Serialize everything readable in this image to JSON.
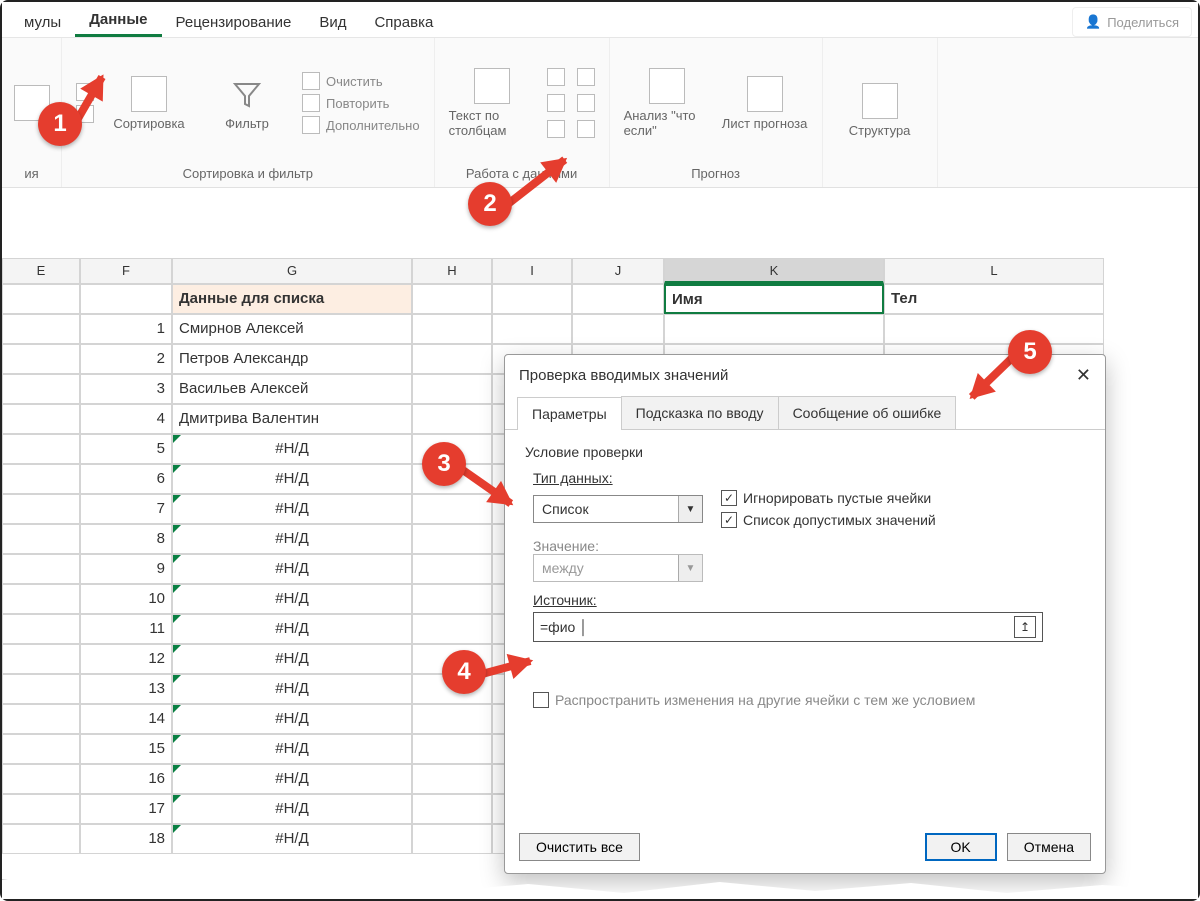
{
  "tabs": {
    "formulas": "мулы",
    "data": "Данные",
    "review": "Рецензирование",
    "view": "Вид",
    "help": "Справка"
  },
  "share": {
    "label": "Поделиться"
  },
  "ribbon": {
    "sort_label": "Сортировка",
    "filter_label": "Фильтр",
    "clear": "Очистить",
    "reapply": "Повторить",
    "advanced": "Дополнительно",
    "group_sortfilter": "Сортировка и фильтр",
    "text_to_columns": "Текст по столбцам",
    "group_datatools": "Работа с данными",
    "whatif": "Анализ \"что если\"",
    "forecast_sheet": "Лист прогноза",
    "group_forecast": "Прогноз",
    "outline": "Структура"
  },
  "columns": {
    "e": "E",
    "f": "F",
    "g": "G",
    "h": "H",
    "i": "I",
    "j": "J",
    "k": "K",
    "l": "L"
  },
  "headers": {
    "g": "Данные для списка",
    "k": "Имя",
    "l": "Тел"
  },
  "rows": [
    {
      "n": 1,
      "g": "Смирнов Алексей"
    },
    {
      "n": 2,
      "g": "Петров Александр"
    },
    {
      "n": 3,
      "g": "Васильев Алексей"
    },
    {
      "n": 4,
      "g": "Дмитрива Валентин"
    },
    {
      "n": 5,
      "g": "#Н/Д"
    },
    {
      "n": 6,
      "g": "#Н/Д"
    },
    {
      "n": 7,
      "g": "#Н/Д"
    },
    {
      "n": 8,
      "g": "#Н/Д"
    },
    {
      "n": 9,
      "g": "#Н/Д"
    },
    {
      "n": 10,
      "g": "#Н/Д"
    },
    {
      "n": 11,
      "g": "#Н/Д"
    },
    {
      "n": 12,
      "g": "#Н/Д"
    },
    {
      "n": 13,
      "g": "#Н/Д"
    },
    {
      "n": 14,
      "g": "#Н/Д"
    },
    {
      "n": 15,
      "g": "#Н/Д"
    },
    {
      "n": 16,
      "g": "#Н/Д"
    },
    {
      "n": 17,
      "g": "#Н/Д"
    },
    {
      "n": 18,
      "g": "#Н/Д"
    }
  ],
  "dialog": {
    "title": "Проверка вводимых значений",
    "tabs": {
      "params": "Параметры",
      "input_msg": "Подсказка по вводу",
      "error_msg": "Сообщение об ошибке"
    },
    "section": "Условие проверки",
    "type_label": "Тип данных:",
    "type_value": "Список",
    "value_label": "Значение:",
    "value_value": "между",
    "ignore_blank": "Игнорировать пустые ячейки",
    "in_cell_dropdown": "Список допустимых значений",
    "source_label": "Источник:",
    "source_value": "=фио",
    "apply_changes": "Распространить изменения на другие ячейки с тем же условием",
    "clear_all": "Очистить все",
    "ok": "OK",
    "cancel": "Отмена"
  },
  "callouts": {
    "c1": "1",
    "c2": "2",
    "c3": "3",
    "c4": "4",
    "c5": "5"
  }
}
